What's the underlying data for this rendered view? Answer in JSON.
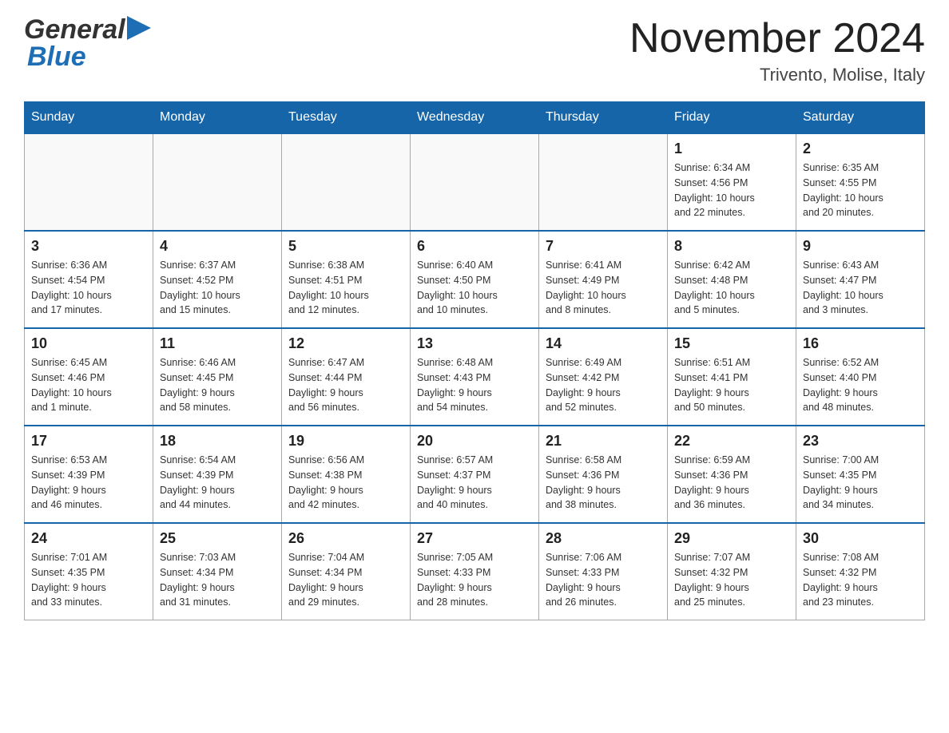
{
  "header": {
    "title": "November 2024",
    "subtitle": "Trivento, Molise, Italy"
  },
  "logo": {
    "part1": "General",
    "part2": "Blue"
  },
  "weekdays": [
    "Sunday",
    "Monday",
    "Tuesday",
    "Wednesday",
    "Thursday",
    "Friday",
    "Saturday"
  ],
  "weeks": [
    [
      {
        "day": "",
        "info": ""
      },
      {
        "day": "",
        "info": ""
      },
      {
        "day": "",
        "info": ""
      },
      {
        "day": "",
        "info": ""
      },
      {
        "day": "",
        "info": ""
      },
      {
        "day": "1",
        "info": "Sunrise: 6:34 AM\nSunset: 4:56 PM\nDaylight: 10 hours\nand 22 minutes."
      },
      {
        "day": "2",
        "info": "Sunrise: 6:35 AM\nSunset: 4:55 PM\nDaylight: 10 hours\nand 20 minutes."
      }
    ],
    [
      {
        "day": "3",
        "info": "Sunrise: 6:36 AM\nSunset: 4:54 PM\nDaylight: 10 hours\nand 17 minutes."
      },
      {
        "day": "4",
        "info": "Sunrise: 6:37 AM\nSunset: 4:52 PM\nDaylight: 10 hours\nand 15 minutes."
      },
      {
        "day": "5",
        "info": "Sunrise: 6:38 AM\nSunset: 4:51 PM\nDaylight: 10 hours\nand 12 minutes."
      },
      {
        "day": "6",
        "info": "Sunrise: 6:40 AM\nSunset: 4:50 PM\nDaylight: 10 hours\nand 10 minutes."
      },
      {
        "day": "7",
        "info": "Sunrise: 6:41 AM\nSunset: 4:49 PM\nDaylight: 10 hours\nand 8 minutes."
      },
      {
        "day": "8",
        "info": "Sunrise: 6:42 AM\nSunset: 4:48 PM\nDaylight: 10 hours\nand 5 minutes."
      },
      {
        "day": "9",
        "info": "Sunrise: 6:43 AM\nSunset: 4:47 PM\nDaylight: 10 hours\nand 3 minutes."
      }
    ],
    [
      {
        "day": "10",
        "info": "Sunrise: 6:45 AM\nSunset: 4:46 PM\nDaylight: 10 hours\nand 1 minute."
      },
      {
        "day": "11",
        "info": "Sunrise: 6:46 AM\nSunset: 4:45 PM\nDaylight: 9 hours\nand 58 minutes."
      },
      {
        "day": "12",
        "info": "Sunrise: 6:47 AM\nSunset: 4:44 PM\nDaylight: 9 hours\nand 56 minutes."
      },
      {
        "day": "13",
        "info": "Sunrise: 6:48 AM\nSunset: 4:43 PM\nDaylight: 9 hours\nand 54 minutes."
      },
      {
        "day": "14",
        "info": "Sunrise: 6:49 AM\nSunset: 4:42 PM\nDaylight: 9 hours\nand 52 minutes."
      },
      {
        "day": "15",
        "info": "Sunrise: 6:51 AM\nSunset: 4:41 PM\nDaylight: 9 hours\nand 50 minutes."
      },
      {
        "day": "16",
        "info": "Sunrise: 6:52 AM\nSunset: 4:40 PM\nDaylight: 9 hours\nand 48 minutes."
      }
    ],
    [
      {
        "day": "17",
        "info": "Sunrise: 6:53 AM\nSunset: 4:39 PM\nDaylight: 9 hours\nand 46 minutes."
      },
      {
        "day": "18",
        "info": "Sunrise: 6:54 AM\nSunset: 4:39 PM\nDaylight: 9 hours\nand 44 minutes."
      },
      {
        "day": "19",
        "info": "Sunrise: 6:56 AM\nSunset: 4:38 PM\nDaylight: 9 hours\nand 42 minutes."
      },
      {
        "day": "20",
        "info": "Sunrise: 6:57 AM\nSunset: 4:37 PM\nDaylight: 9 hours\nand 40 minutes."
      },
      {
        "day": "21",
        "info": "Sunrise: 6:58 AM\nSunset: 4:36 PM\nDaylight: 9 hours\nand 38 minutes."
      },
      {
        "day": "22",
        "info": "Sunrise: 6:59 AM\nSunset: 4:36 PM\nDaylight: 9 hours\nand 36 minutes."
      },
      {
        "day": "23",
        "info": "Sunrise: 7:00 AM\nSunset: 4:35 PM\nDaylight: 9 hours\nand 34 minutes."
      }
    ],
    [
      {
        "day": "24",
        "info": "Sunrise: 7:01 AM\nSunset: 4:35 PM\nDaylight: 9 hours\nand 33 minutes."
      },
      {
        "day": "25",
        "info": "Sunrise: 7:03 AM\nSunset: 4:34 PM\nDaylight: 9 hours\nand 31 minutes."
      },
      {
        "day": "26",
        "info": "Sunrise: 7:04 AM\nSunset: 4:34 PM\nDaylight: 9 hours\nand 29 minutes."
      },
      {
        "day": "27",
        "info": "Sunrise: 7:05 AM\nSunset: 4:33 PM\nDaylight: 9 hours\nand 28 minutes."
      },
      {
        "day": "28",
        "info": "Sunrise: 7:06 AM\nSunset: 4:33 PM\nDaylight: 9 hours\nand 26 minutes."
      },
      {
        "day": "29",
        "info": "Sunrise: 7:07 AM\nSunset: 4:32 PM\nDaylight: 9 hours\nand 25 minutes."
      },
      {
        "day": "30",
        "info": "Sunrise: 7:08 AM\nSunset: 4:32 PM\nDaylight: 9 hours\nand 23 minutes."
      }
    ]
  ]
}
